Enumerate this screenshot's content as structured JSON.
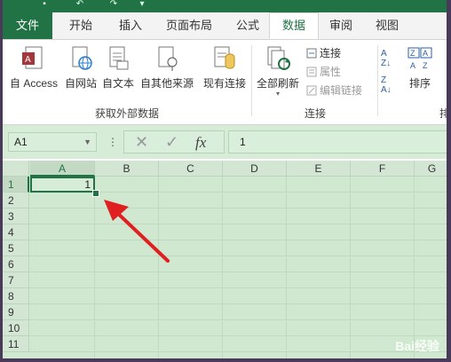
{
  "tabs": [
    {
      "label": "文件",
      "kind": "file"
    },
    {
      "label": "开始",
      "kind": "normal"
    },
    {
      "label": "插入",
      "kind": "normal"
    },
    {
      "label": "页面布局",
      "kind": "normal"
    },
    {
      "label": "公式",
      "kind": "normal"
    },
    {
      "label": "数据",
      "kind": "active"
    },
    {
      "label": "审阅",
      "kind": "normal"
    },
    {
      "label": "视图",
      "kind": "normal"
    }
  ],
  "ribbon": {
    "external": {
      "group_label": "获取外部数据",
      "access": "自 Access",
      "web": "自网站",
      "text": "自文本",
      "other": "自其他来源",
      "existing": "现有连接"
    },
    "connections": {
      "group_label": "连接",
      "refresh_all": "全部刷新",
      "connections": "连接",
      "properties": "属性",
      "edit_links": "编辑链接"
    },
    "sort": {
      "sort": "排序",
      "group_label_partial": "排"
    }
  },
  "formula_bar": {
    "name_box": "A1",
    "dots": "⋮",
    "fx": "fx",
    "value": "1"
  },
  "grid": {
    "columns": [
      "A",
      "B",
      "C",
      "D",
      "E",
      "F",
      "G"
    ],
    "rows": [
      "1",
      "2",
      "3",
      "4",
      "5",
      "6",
      "7",
      "8",
      "9",
      "10",
      "11"
    ],
    "selected_cell_value": "1"
  },
  "watermark": "Bai经验",
  "colors": {
    "accent": "#217346",
    "arrow": "#e02020",
    "grid_bg": "#cfe8cf"
  }
}
